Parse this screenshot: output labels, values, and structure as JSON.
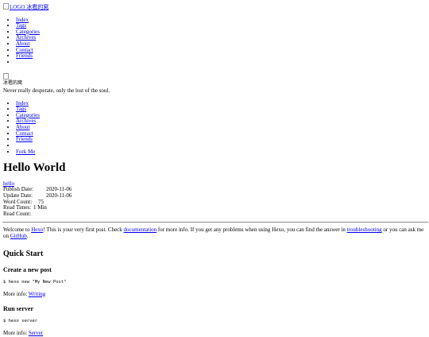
{
  "header": {
    "logo_alt": "LOGO",
    "logo_suffix": "冰雹的窝"
  },
  "nav_top": {
    "items": [
      {
        "label": "Index"
      },
      {
        "label": "Tags"
      },
      {
        "label": "Categories"
      },
      {
        "label": "Archives"
      },
      {
        "label": "About"
      },
      {
        "label": "Contact"
      },
      {
        "label": "Friends"
      },
      {
        "label": ""
      }
    ]
  },
  "profile": {
    "name": "冰雹的窝",
    "motto": "Never really desperate, only the lost of the soul."
  },
  "nav_side": {
    "items": [
      {
        "label": "Index"
      },
      {
        "label": "Tags"
      },
      {
        "label": "Categories"
      },
      {
        "label": "Archives"
      },
      {
        "label": "About"
      },
      {
        "label": "Contact"
      },
      {
        "label": "Friends"
      },
      {
        "label": ""
      }
    ],
    "fork_label": "Fork Me"
  },
  "post": {
    "title": "Hello World",
    "tag": "hello",
    "meta": [
      {
        "key": "Publish Date:",
        "value": "2020-11-06"
      },
      {
        "key": "Update Date:",
        "value": "2020-11-06"
      },
      {
        "key": "Word Count:",
        "value": "75"
      },
      {
        "key": "Read Times:",
        "value": "1 Min"
      },
      {
        "key": "Read Count:",
        "value": ""
      }
    ],
    "intro": {
      "t1": "Welcome to ",
      "link_hexo": "Hexo",
      "t2": "! This is your very first post. Check ",
      "link_docs": "documentation",
      "t3": " for more info. If you get any problems when using Hexo, you can find the answer in ",
      "link_trouble": "troubleshooting",
      "t4": " or you can ask me on ",
      "link_github": "GitHub",
      "t5": "."
    },
    "quick_start": "Quick Start",
    "create_heading": "Create a new post",
    "create_code": "$ hexo new \"My New Post\"",
    "create_more_prefix": "More info: ",
    "create_more_link": "Writing",
    "run_heading": "Run server",
    "run_code": "$ hexo server",
    "run_more_prefix": "More info: ",
    "run_more_link": "Server"
  },
  "colors": {
    "link": "#0000ee",
    "text": "#000000",
    "rule": "#8c8c8c"
  }
}
